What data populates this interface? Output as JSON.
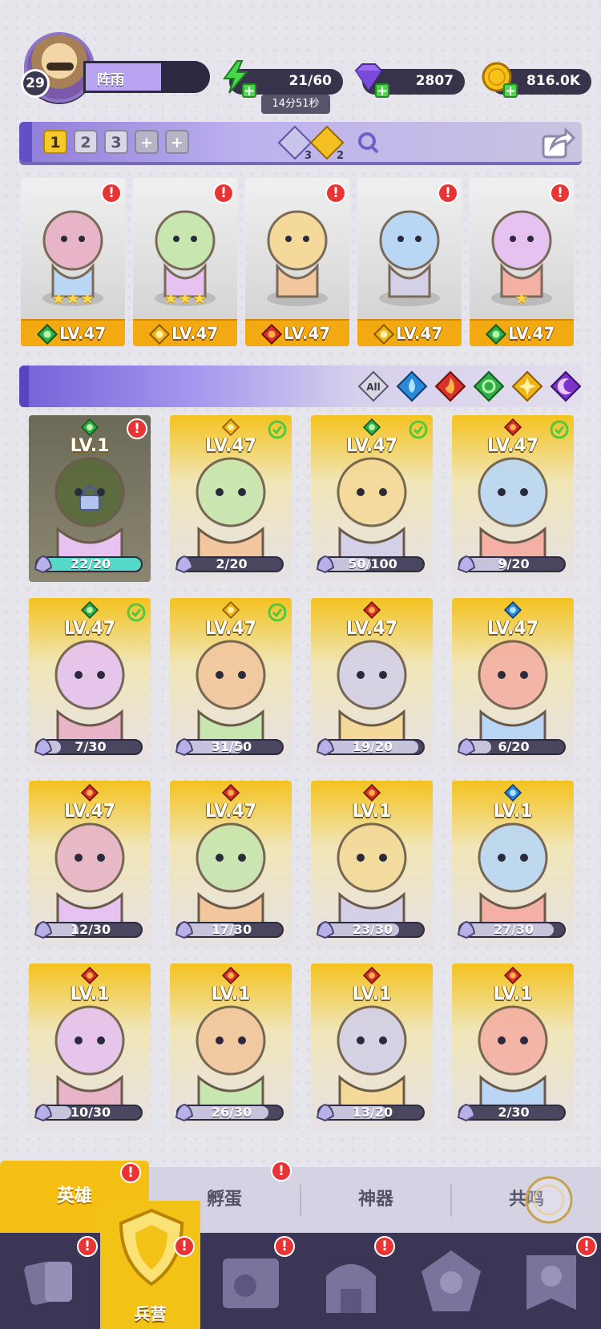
{
  "player": {
    "level": "29",
    "name": "阵雨"
  },
  "resources": {
    "energy": "21/60",
    "energy_timer": "14分51秒",
    "gems": "2807",
    "gold": "816.0K"
  },
  "team": {
    "slots": [
      "1",
      "2",
      "3"
    ],
    "add_labels": [
      "+",
      "+"
    ],
    "badge_a": "3",
    "badge_b": "2",
    "cards": [
      {
        "element": "wind",
        "level": "LV.47",
        "stars": "★★★",
        "alert": "!"
      },
      {
        "element": "light",
        "level": "LV.47",
        "stars": "★★★",
        "alert": "!"
      },
      {
        "element": "fire",
        "level": "LV.47",
        "stars": "",
        "alert": "!"
      },
      {
        "element": "light",
        "level": "LV.47",
        "stars": "",
        "alert": "!"
      },
      {
        "element": "wind",
        "level": "LV.47",
        "stars": "★",
        "alert": "!"
      }
    ]
  },
  "filters": {
    "all_label": "All",
    "items": [
      "all",
      "water",
      "fire",
      "wind",
      "light",
      "dark"
    ]
  },
  "heroes": [
    {
      "element": "wind",
      "level": "LV.1",
      "shard": "22/20",
      "progress": 1.0,
      "status": "alert",
      "locked": true
    },
    {
      "element": "light",
      "level": "LV.47",
      "shard": "2/20",
      "progress": 0.1,
      "status": "check",
      "locked": false
    },
    {
      "element": "wind",
      "level": "LV.47",
      "shard": "50/100",
      "progress": 0.5,
      "status": "check",
      "locked": false
    },
    {
      "element": "fire",
      "level": "LV.47",
      "shard": "9/20",
      "progress": 0.45,
      "status": "check",
      "locked": false
    },
    {
      "element": "wind",
      "level": "LV.47",
      "shard": "7/30",
      "progress": 0.23,
      "status": "check",
      "locked": false
    },
    {
      "element": "light",
      "level": "LV.47",
      "shard": "31/50",
      "progress": 0.62,
      "status": "check",
      "locked": false
    },
    {
      "element": "fire",
      "level": "LV.47",
      "shard": "19/20",
      "progress": 0.95,
      "status": "",
      "locked": false
    },
    {
      "element": "water",
      "level": "LV.47",
      "shard": "6/20",
      "progress": 0.3,
      "status": "",
      "locked": false
    },
    {
      "element": "fire",
      "level": "LV.47",
      "shard": "12/30",
      "progress": 0.4,
      "status": "",
      "locked": false
    },
    {
      "element": "fire",
      "level": "LV.47",
      "shard": "17/30",
      "progress": 0.57,
      "status": "",
      "locked": false
    },
    {
      "element": "fire",
      "level": "LV.1",
      "shard": "23/30",
      "progress": 0.77,
      "status": "",
      "locked": false
    },
    {
      "element": "water",
      "level": "LV.1",
      "shard": "27/30",
      "progress": 0.9,
      "status": "",
      "locked": false
    },
    {
      "element": "fire",
      "level": "LV.1",
      "shard": "10/30",
      "progress": 0.33,
      "status": "",
      "locked": false
    },
    {
      "element": "fire",
      "level": "LV.1",
      "shard": "26/30",
      "progress": 0.87,
      "status": "",
      "locked": false
    },
    {
      "element": "fire",
      "level": "LV.1",
      "shard": "13/20",
      "progress": 0.65,
      "status": "",
      "locked": false
    },
    {
      "element": "fire",
      "level": "LV.1",
      "shard": "2/30",
      "progress": 0.07,
      "status": "",
      "locked": false
    }
  ],
  "sub_tabs": [
    "英雄",
    "孵蛋",
    "神器",
    "共鸣"
  ],
  "nav": {
    "barracks_label": "兵营"
  },
  "colors": {
    "accent_purple": "#8f7cd9",
    "gold": "#f5c013",
    "alert_red": "#e83434",
    "check_green": "#54c83c"
  }
}
